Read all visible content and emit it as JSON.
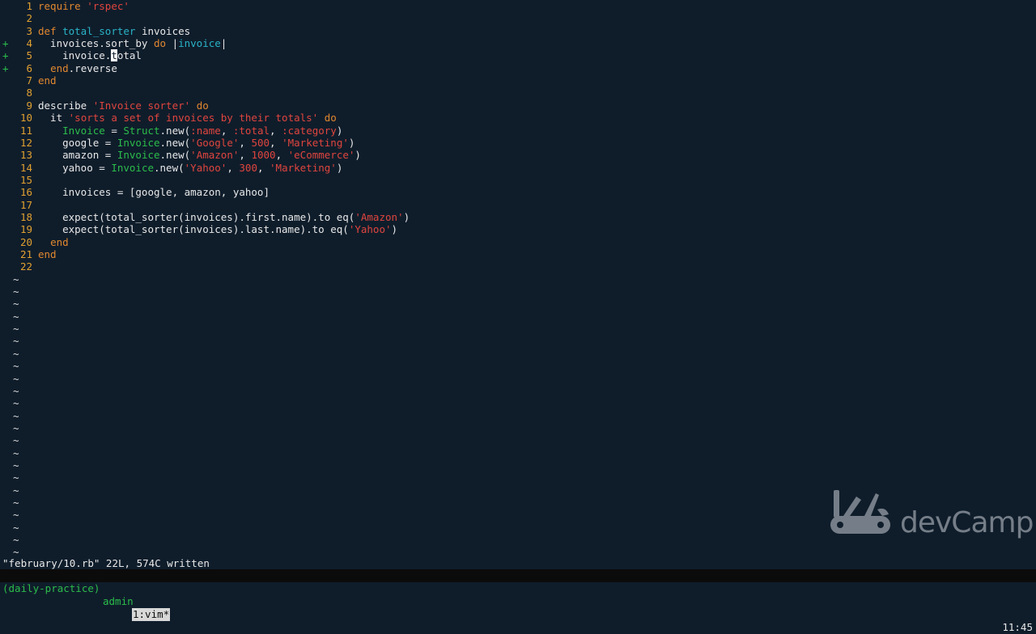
{
  "editor": {
    "lines": [
      {
        "num": "1",
        "sign": "",
        "tokens": [
          [
            "kw",
            "require "
          ],
          [
            "str",
            "'rspec'"
          ]
        ]
      },
      {
        "num": "2",
        "sign": "",
        "tokens": []
      },
      {
        "num": "3",
        "sign": "",
        "tokens": [
          [
            "kw",
            "def "
          ],
          [
            "fn",
            "total_sorter"
          ],
          [
            "plain",
            " invoices"
          ]
        ]
      },
      {
        "num": "4",
        "sign": "+",
        "tokens": [
          [
            "plain",
            "  invoices.sort_by "
          ],
          [
            "kw",
            "do "
          ],
          [
            "plain",
            "|"
          ],
          [
            "blk",
            "invoice"
          ],
          [
            "plain",
            "|"
          ]
        ]
      },
      {
        "num": "5",
        "sign": "+",
        "tokens": [
          [
            "plain",
            "    invoice."
          ],
          [
            "cursor",
            "t"
          ],
          [
            "plain",
            "otal"
          ]
        ]
      },
      {
        "num": "6",
        "sign": "+",
        "tokens": [
          [
            "plain",
            "  "
          ],
          [
            "kw",
            "end"
          ],
          [
            "plain",
            ".reverse"
          ]
        ]
      },
      {
        "num": "7",
        "sign": "",
        "tokens": [
          [
            "kw",
            "end"
          ]
        ]
      },
      {
        "num": "8",
        "sign": "",
        "tokens": []
      },
      {
        "num": "9",
        "sign": "",
        "tokens": [
          [
            "plain",
            "describe "
          ],
          [
            "str",
            "'Invoice sorter'"
          ],
          [
            "plain",
            " "
          ],
          [
            "kw",
            "do"
          ]
        ]
      },
      {
        "num": "10",
        "sign": "",
        "tokens": [
          [
            "plain",
            "  it "
          ],
          [
            "str",
            "'sorts a set of invoices by their totals'"
          ],
          [
            "plain",
            " "
          ],
          [
            "kw",
            "do"
          ]
        ]
      },
      {
        "num": "11",
        "sign": "",
        "tokens": [
          [
            "plain",
            "    "
          ],
          [
            "const",
            "Invoice"
          ],
          [
            "plain",
            " = "
          ],
          [
            "const",
            "Struct"
          ],
          [
            "plain",
            ".new("
          ],
          [
            "sym",
            ":name"
          ],
          [
            "plain",
            ", "
          ],
          [
            "sym",
            ":total"
          ],
          [
            "plain",
            ", "
          ],
          [
            "sym",
            ":category"
          ],
          [
            "plain",
            ")"
          ]
        ]
      },
      {
        "num": "12",
        "sign": "",
        "tokens": [
          [
            "plain",
            "    google = "
          ],
          [
            "const",
            "Invoice"
          ],
          [
            "plain",
            ".new("
          ],
          [
            "str",
            "'Google'"
          ],
          [
            "plain",
            ", "
          ],
          [
            "num",
            "500"
          ],
          [
            "plain",
            ", "
          ],
          [
            "str",
            "'Marketing'"
          ],
          [
            "plain",
            ")"
          ]
        ]
      },
      {
        "num": "13",
        "sign": "",
        "tokens": [
          [
            "plain",
            "    amazon = "
          ],
          [
            "const",
            "Invoice"
          ],
          [
            "plain",
            ".new("
          ],
          [
            "str",
            "'Amazon'"
          ],
          [
            "plain",
            ", "
          ],
          [
            "num",
            "1000"
          ],
          [
            "plain",
            ", "
          ],
          [
            "str",
            "'eCommerce'"
          ],
          [
            "plain",
            ")"
          ]
        ]
      },
      {
        "num": "14",
        "sign": "",
        "tokens": [
          [
            "plain",
            "    yahoo = "
          ],
          [
            "const",
            "Invoice"
          ],
          [
            "plain",
            ".new("
          ],
          [
            "str",
            "'Yahoo'"
          ],
          [
            "plain",
            ", "
          ],
          [
            "num",
            "300"
          ],
          [
            "plain",
            ", "
          ],
          [
            "str",
            "'Marketing'"
          ],
          [
            "plain",
            ")"
          ]
        ]
      },
      {
        "num": "15",
        "sign": "",
        "tokens": []
      },
      {
        "num": "16",
        "sign": "",
        "tokens": [
          [
            "plain",
            "    invoices = [google, amazon, yahoo]"
          ]
        ]
      },
      {
        "num": "17",
        "sign": "",
        "tokens": []
      },
      {
        "num": "18",
        "sign": "",
        "tokens": [
          [
            "plain",
            "    expect(total_sorter(invoices).first.name).to eq("
          ],
          [
            "str",
            "'Amazon'"
          ],
          [
            "plain",
            ")"
          ]
        ]
      },
      {
        "num": "19",
        "sign": "",
        "tokens": [
          [
            "plain",
            "    expect(total_sorter(invoices).last.name).to eq("
          ],
          [
            "str",
            "'Yahoo'"
          ],
          [
            "plain",
            ")"
          ]
        ]
      },
      {
        "num": "20",
        "sign": "",
        "tokens": [
          [
            "plain",
            "  "
          ],
          [
            "kw",
            "end"
          ]
        ]
      },
      {
        "num": "21",
        "sign": "",
        "tokens": [
          [
            "kw",
            "end"
          ]
        ]
      },
      {
        "num": "22",
        "sign": "",
        "tokens": []
      }
    ],
    "empty_line_marker": "~",
    "empty_line_count": 23
  },
  "message_line": "\"february/10.rb\" 22L, 574C written",
  "tmux": {
    "session": "(daily-practice)",
    "host": "admin",
    "window": "1:vim*",
    "clock": "11:45"
  },
  "watermark": {
    "brand": "devCamp",
    "icon": "swiss-army-knife-icon"
  }
}
